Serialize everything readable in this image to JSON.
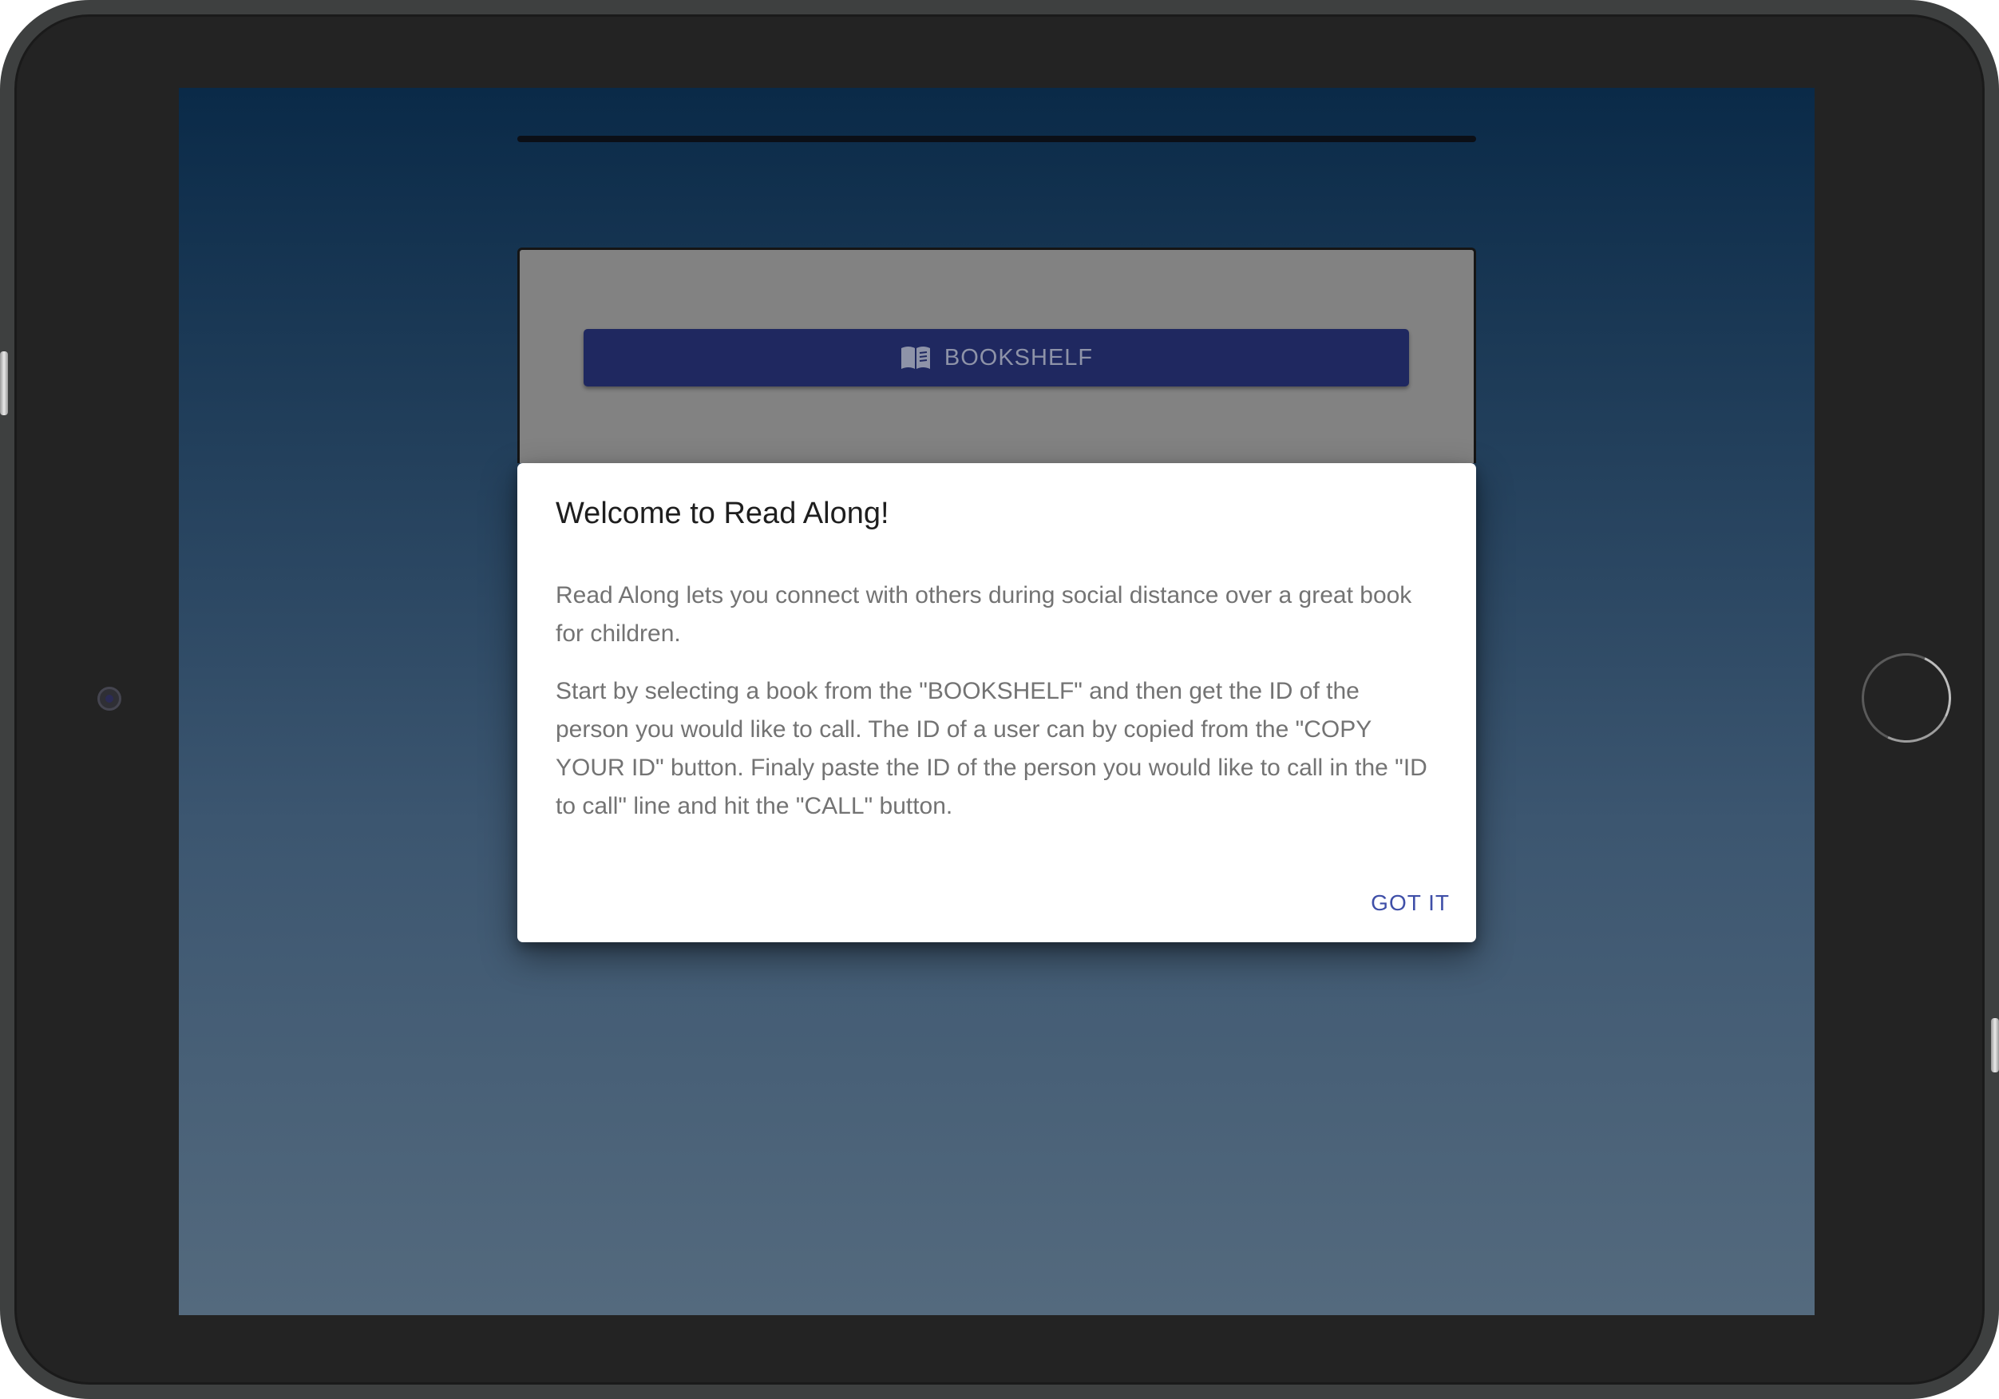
{
  "app": {
    "bookshelf_button": {
      "label": "BOOKSHELF",
      "icon": "open-book-icon"
    }
  },
  "dialog": {
    "title": "Welcome to Read Along!",
    "paragraphs": [
      "Read Along lets you connect with others during social distance over a great book for children.",
      "Start by selecting a book from the \"BOOKSHELF\" and then get the ID of the person you would like to call. The ID of a user can by copied from the \"COPY YOUR ID\" button. Finaly paste the ID of the person you would like to call in the \"ID to call\" line and hit the \"CALL\" button."
    ],
    "action_label": "GOT IT"
  },
  "colors": {
    "button_background": "#1f2860",
    "dialog_action": "#3f4fa8",
    "backdrop_top": "#0a2a48",
    "backdrop_bottom": "#546a7e"
  }
}
